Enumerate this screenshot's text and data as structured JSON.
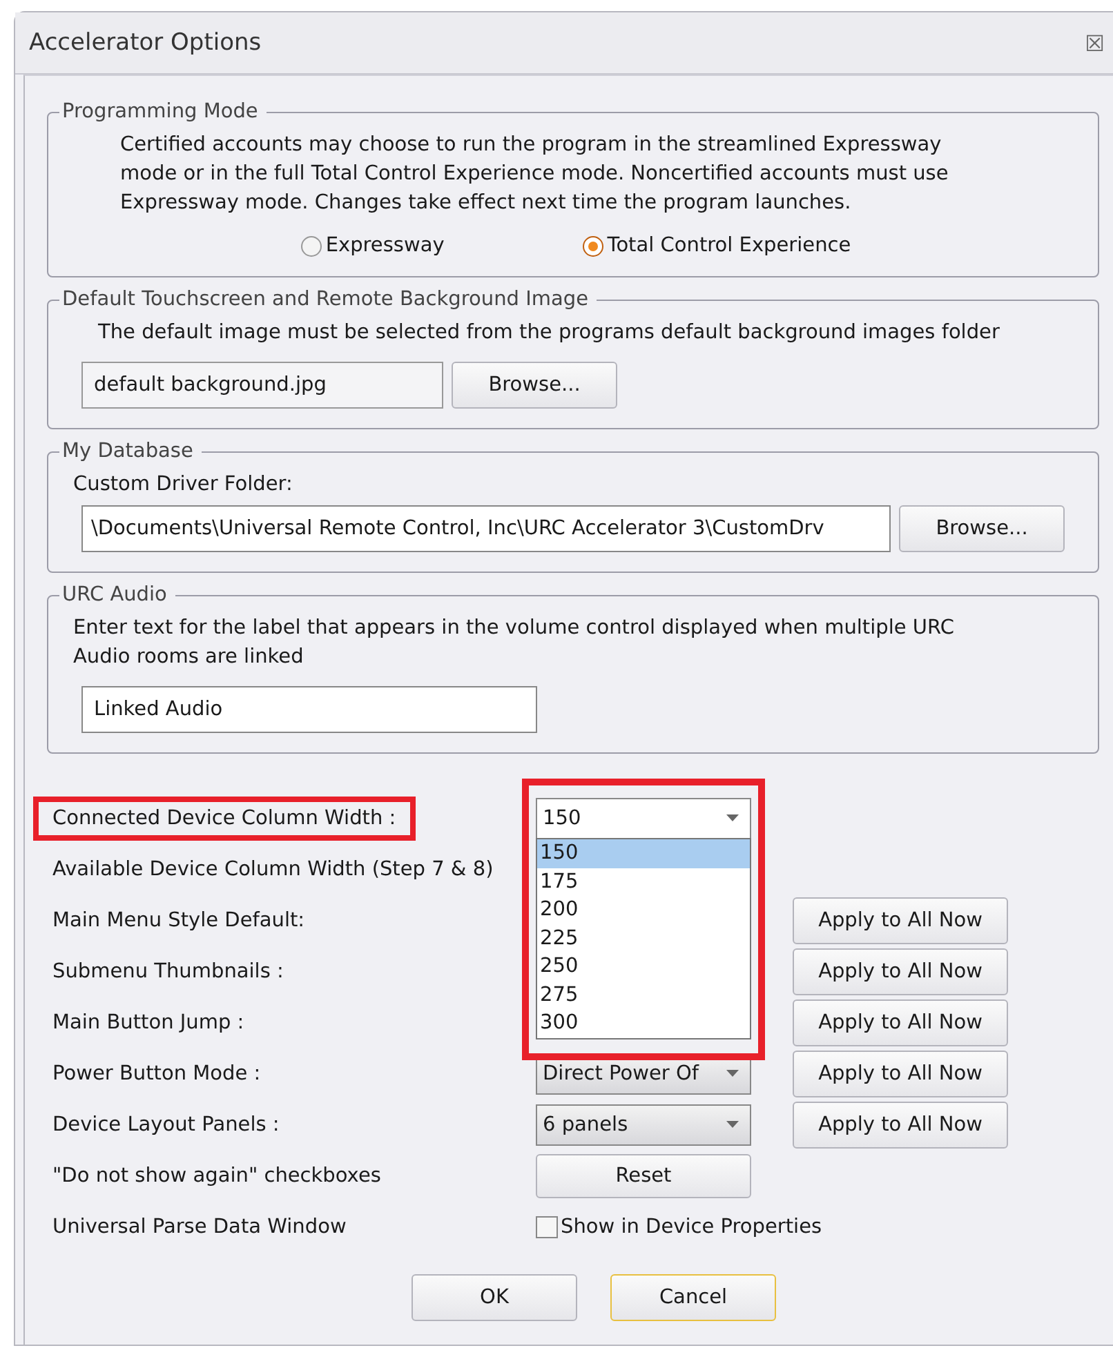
{
  "window": {
    "title": "Accelerator Options",
    "close": "☒"
  },
  "groups": [
    {
      "kind": "radio",
      "title": "Programming Mode",
      "text": "Certified accounts may choose to run the program in the streamlined Expressway mode or in the full Total Control Experience mode. Noncertified accounts must use Expressway mode. Changes take effect next time the program launches.",
      "options": [
        {
          "label": "Expressway",
          "selected": false
        },
        {
          "label": "Total Control Experience",
          "selected": true
        }
      ]
    },
    {
      "kind": "file",
      "title": "Default Touchscreen and Remote Background Image",
      "text": "The default image must be selected from the programs default background images folder",
      "value": "default background.jpg",
      "button": "Browse..."
    },
    {
      "kind": "folder",
      "title": "My Database",
      "text": "Custom Driver Folder:",
      "value": "\\Documents\\Universal Remote Control, Inc\\URC Accelerator 3\\CustomDrv",
      "button": "Browse..."
    },
    {
      "kind": "text",
      "title": "URC Audio",
      "text": "Enter text for the label that appears in the volume control displayed when multiple URC Audio rooms are linked",
      "value": "Linked Audio"
    }
  ],
  "settings": [
    {
      "label": "Connected Device Column Width :",
      "kind": "combo",
      "value": "150",
      "highlighted": true,
      "open": true,
      "options": [
        {
          "label": "150",
          "selected": true
        },
        {
          "label": "175",
          "selected": false
        },
        {
          "label": "200",
          "selected": false
        },
        {
          "label": "225",
          "selected": false
        },
        {
          "label": "250",
          "selected": false
        },
        {
          "label": "275",
          "selected": false
        },
        {
          "label": "300",
          "selected": false
        }
      ]
    },
    {
      "label": "Available Device Column Width (Step 7 & 8)",
      "kind": "hidden",
      "highlighted": false
    },
    {
      "label": "Main Menu Style Default:",
      "kind": "hidden",
      "apply": "Apply to All Now",
      "highlighted": false
    },
    {
      "label": "Submenu Thumbnails :",
      "kind": "hidden",
      "apply": "Apply to All Now",
      "highlighted": false
    },
    {
      "label": "Main Button Jump :",
      "kind": "hidden",
      "apply": "Apply to All Now",
      "highlighted": false
    },
    {
      "label": "Power Button Mode :",
      "kind": "combo",
      "value": "Direct Power Of",
      "apply": "Apply to All Now",
      "highlighted": false
    },
    {
      "label": "Device Layout Panels :",
      "kind": "combo",
      "value": "6 panels",
      "apply": "Apply to All Now",
      "highlighted": false
    },
    {
      "label": "\"Do not show again\" checkboxes",
      "kind": "button",
      "value": "Reset",
      "highlighted": false
    },
    {
      "label": "Universal Parse Data Window",
      "kind": "checkbox",
      "value": "Show in Device Properties",
      "checked": false,
      "highlighted": false
    }
  ],
  "buttons": [
    {
      "label": "OK",
      "default": false
    },
    {
      "label": "Cancel",
      "default": true
    }
  ]
}
